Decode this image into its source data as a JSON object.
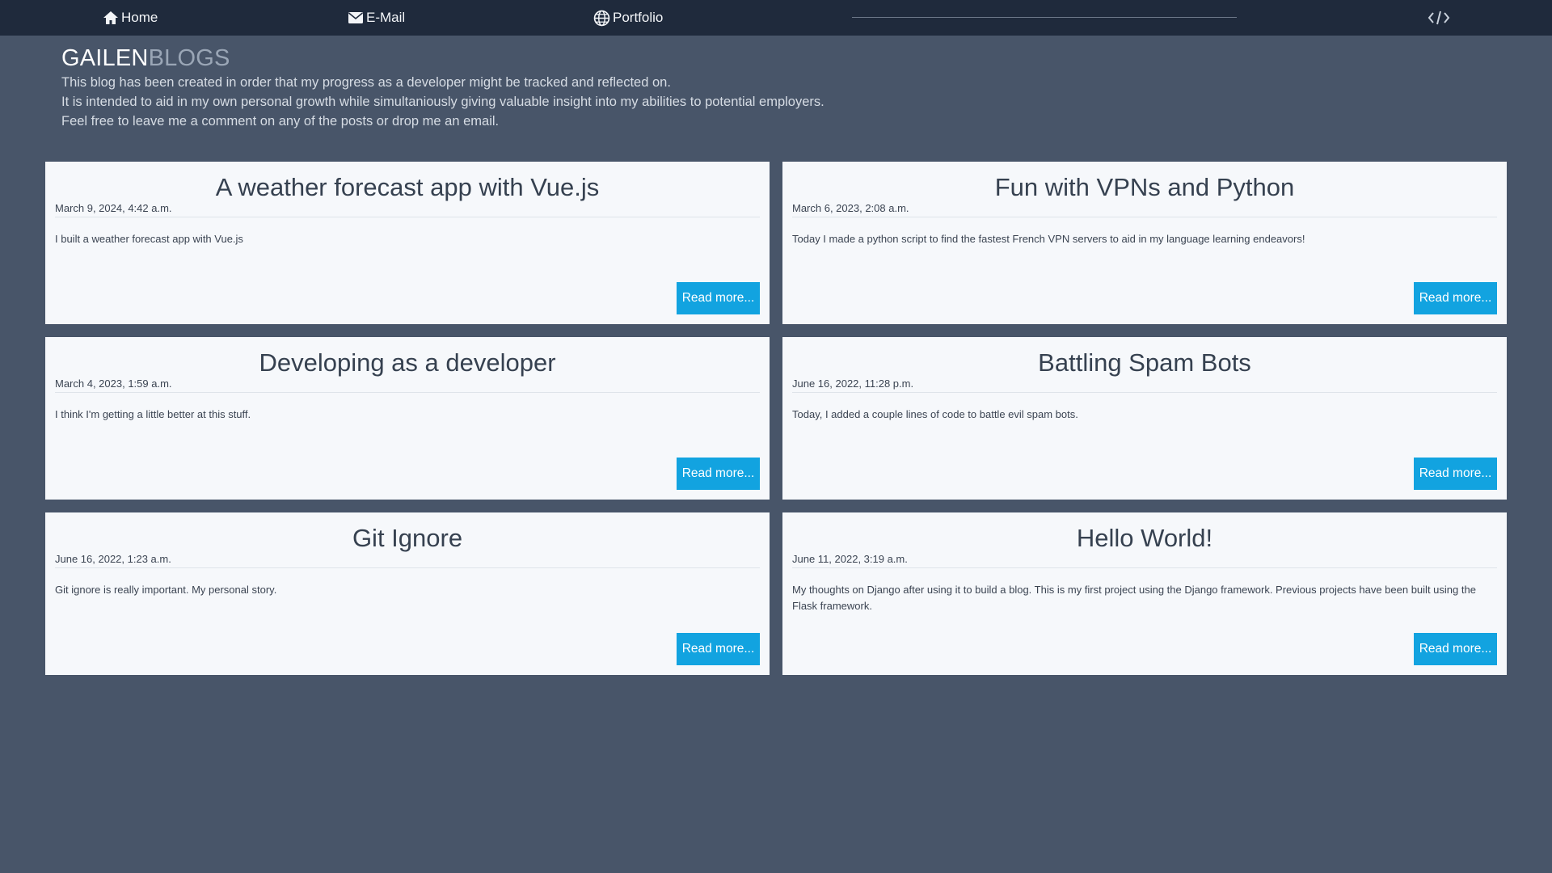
{
  "nav": {
    "home": "Home",
    "email": "E-Mail",
    "portfolio": "Portfolio"
  },
  "header": {
    "brand_part1": "GAILEN",
    "brand_part2": "BLOGS",
    "intro": [
      "This blog has been created in order that my progress as a developer might be tracked and reflected on.",
      "It is intended to aid in my own personal growth while simultaniously giving valuable insight into my abilities to potential employers.",
      "Feel free to leave me a comment on any of the posts or drop me an email."
    ]
  },
  "read_more_label": "Read more...",
  "posts": [
    {
      "title": "A weather forecast app with Vue.js",
      "date": "March 9, 2024, 4:42 a.m.",
      "summary": "I built a weather forecast app with Vue.js"
    },
    {
      "title": "Fun with VPNs and Python",
      "date": "March 6, 2023, 2:08 a.m.",
      "summary": "Today I made a python script to find the fastest French VPN servers to aid in my language learning endeavors!"
    },
    {
      "title": "Developing as a developer",
      "date": "March 4, 2023, 1:59 a.m.",
      "summary": "I think I'm getting a little better at this stuff."
    },
    {
      "title": "Battling Spam Bots",
      "date": "June 16, 2022, 11:28 p.m.",
      "summary": "Today, I added a couple lines of code to battle evil spam bots."
    },
    {
      "title": "Git Ignore",
      "date": "June 16, 2022, 1:23 a.m.",
      "summary": "Git ignore is really important. My personal story."
    },
    {
      "title": "Hello World!",
      "date": "June 11, 2022, 3:19 a.m.",
      "summary": "My thoughts on Django after using it to build a blog. This is my first project using the Django framework. Previous projects have been built using the Flask framework."
    }
  ],
  "colors": {
    "background": "#485569",
    "navbar": "#1f2a3c",
    "card": "#f6f8fb",
    "button": "#12a3e0"
  }
}
